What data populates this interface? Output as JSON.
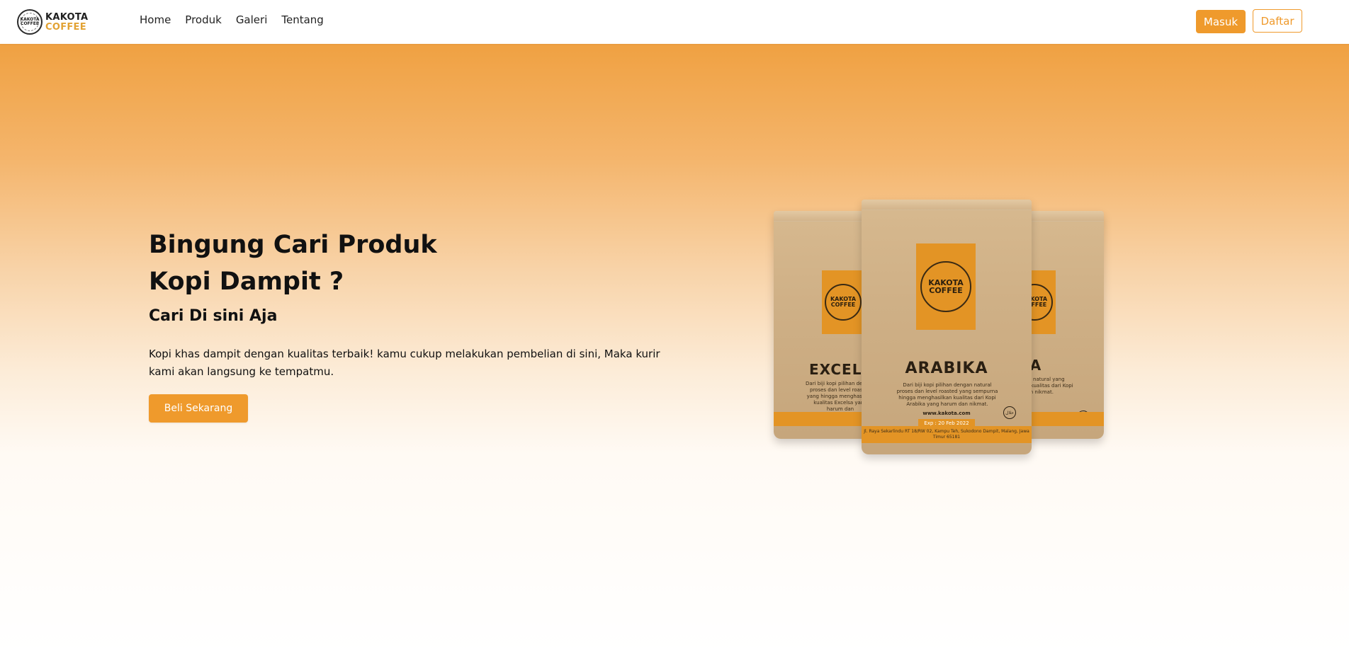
{
  "brand": {
    "line1": "KAKOTA",
    "line2": "COFFEE",
    "badge_text": "KAKOTA COFFEE"
  },
  "nav": {
    "items": [
      {
        "label": "Home"
      },
      {
        "label": "Produk"
      },
      {
        "label": "Galeri"
      },
      {
        "label": "Tentang"
      }
    ]
  },
  "auth": {
    "login_label": "Masuk",
    "register_label": "Daftar"
  },
  "hero": {
    "headline_line1": "Bingung Cari Produk",
    "headline_line2": "Kopi Dampit ?",
    "subhead": "Cari Di sini Aja",
    "description": "Kopi khas dampit dengan kualitas terbaik! kamu cukup melakukan pembelian di sini, Maka kurir kami akan langsung ke tempatmu.",
    "cta_label": "Beli Sekarang"
  },
  "products": {
    "left_name": "EXCELS",
    "center_name": "ARABIKA",
    "right_name": "USTA",
    "seal_text": "KAKOTA COFFEE",
    "center_desc": "Dari biji kopi pilihan dengan natural proses dan level roasted yang sempurna hingga menghasilkan kualitas dari Kopi Arabika yang harum dan nikmat.",
    "left_desc": "Dari biji kopi pilihan dengan proses dan level roasted yang hingga menghasilkan kualitas Excelsa yang harum dan",
    "right_desc": "dengan natural yang sempurna kualitas dari Kopi dan nikmat.",
    "website": "www.kakota.com",
    "exp": "Exp : 20 Feb 2022",
    "address": "Jl. Raya Sekarlindu RT 18/RW 02, Kampu Teh, Sukodono Dampit, Malang, Jawa Timur 65181",
    "halal": "حلال"
  },
  "colors": {
    "accent": "#ef9a2c",
    "hero_top": "#f0a142",
    "text": "#111111"
  }
}
